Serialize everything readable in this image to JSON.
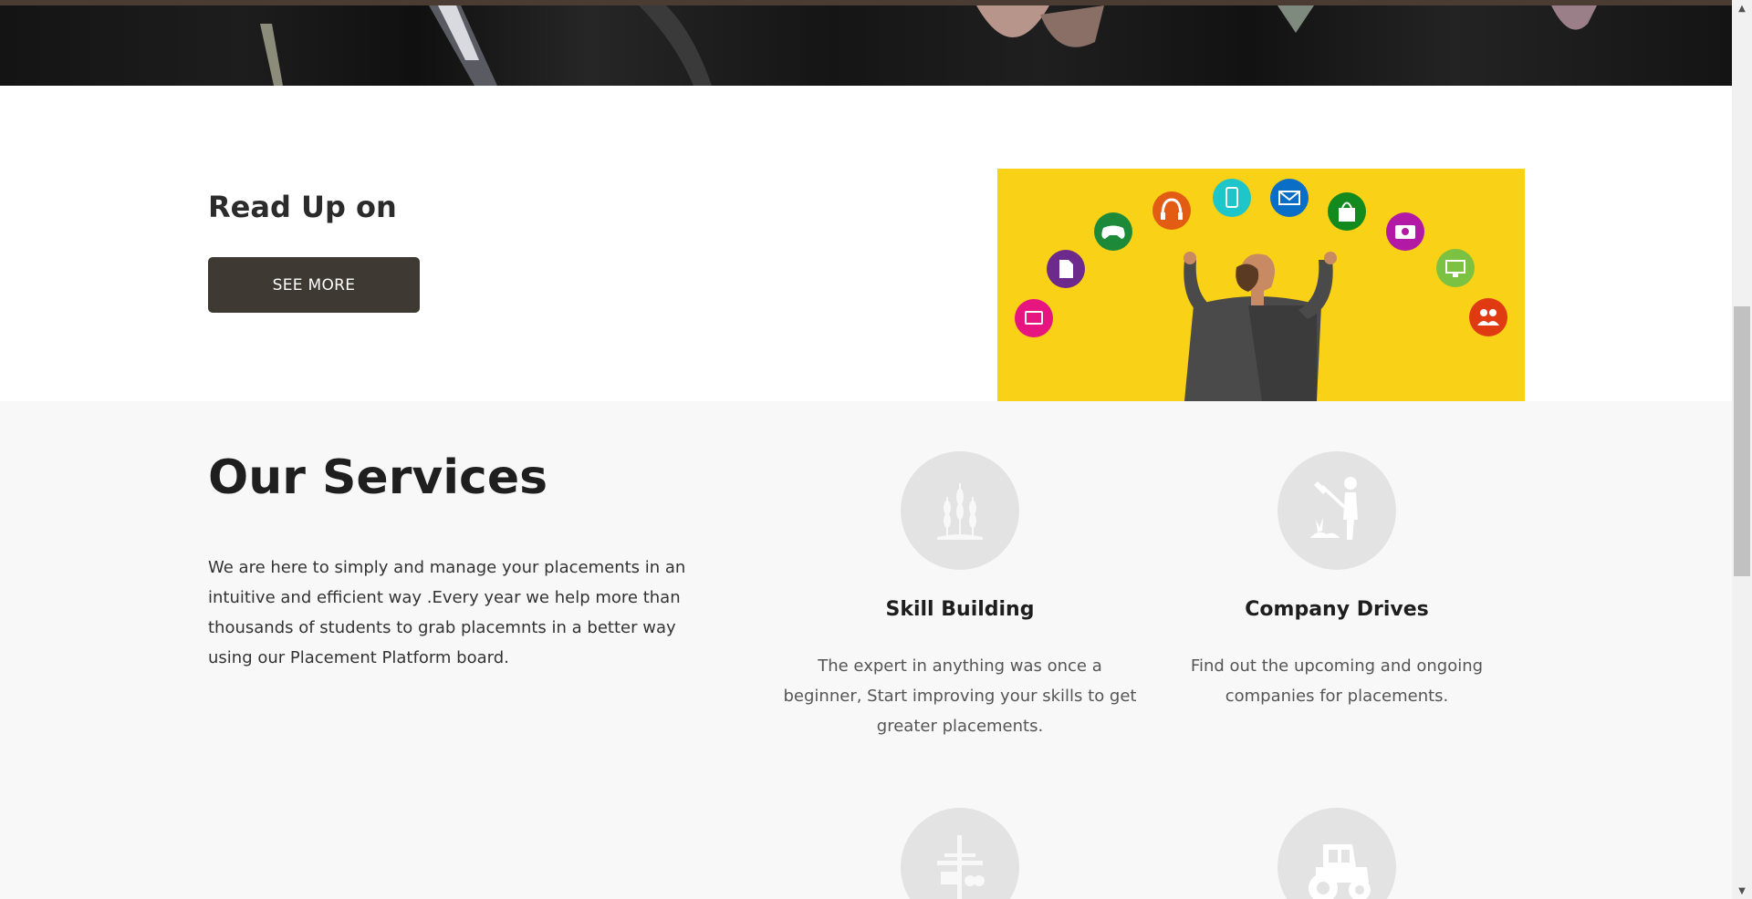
{
  "readup": {
    "title": "Read Up on",
    "button_label": "SEE MORE"
  },
  "services": {
    "title": "Our Services",
    "description": "We are here to simply and manage your placements in an intuitive and efficient way .Every year we help more than thousands of students to grab placemnts in a better way using our Placement Platform board.",
    "items": [
      {
        "icon": "wheat-icon",
        "title": "Skill Building",
        "text": "The expert in anything was once a beginner, Start improving your skills to get greater placements."
      },
      {
        "icon": "farmer-icon",
        "title": "Company Drives",
        "text": "Find out the upcoming and ongoing companies for placements."
      },
      {
        "icon": "windmill-icon",
        "title": "",
        "text": ""
      },
      {
        "icon": "tractor-icon",
        "title": "",
        "text": ""
      }
    ]
  },
  "illustration": {
    "background_color": "#f9d116",
    "icons": [
      "tablet-icon",
      "document-icon",
      "gamepad-icon",
      "headphones-icon",
      "phone-icon",
      "mail-icon",
      "shopping-bag-icon",
      "camera-icon",
      "monitor-icon",
      "people-icon"
    ]
  },
  "colors": {
    "button_bg": "#3e3a33",
    "services_bg": "#f8f8f8",
    "icon_circle": "#e3e3e3"
  }
}
